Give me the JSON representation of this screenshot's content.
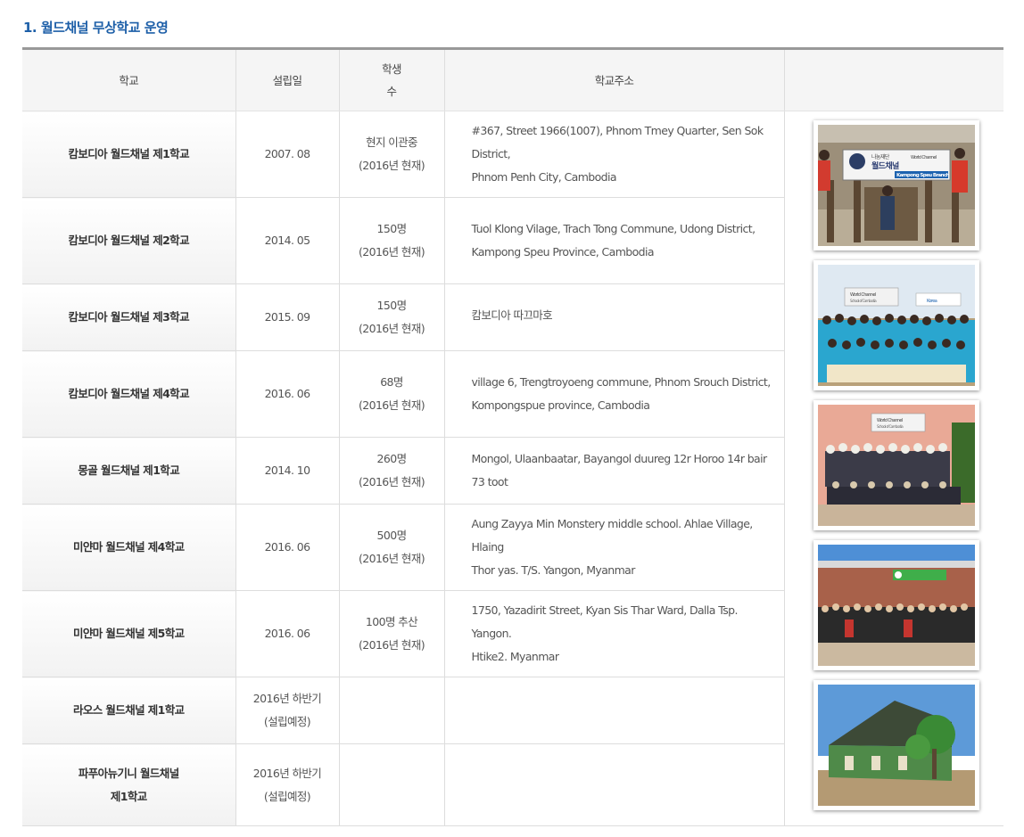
{
  "section_title": "1. 월드채널 무상학교 운영",
  "headers": {
    "school": "학교",
    "founded": "설립일",
    "students_line1": "학생",
    "students_line2": "수",
    "address": "학교주소",
    "photo": ""
  },
  "rows": [
    {
      "school": "캄보디아 월드채널 제1학교",
      "date": "2007. 08",
      "count": "현지 이관중",
      "count_note": "(2016년 현재)",
      "addr1": "#367, Street 1966(1007), Phnom Tmey Quarter, Sen Sok District,",
      "addr2": "Phnom Penh City, Cambodia"
    },
    {
      "school": "캄보디아 월드채널 제2학교",
      "date": "2014. 05",
      "count": "150명",
      "count_note": "(2016년 현재)",
      "addr1": "Tuol Klong Vilage, Trach Tong Commune, Udong District,",
      "addr2": "Kampong Speu Province, Cambodia"
    },
    {
      "school": "캄보디아 월드채널 제3학교",
      "date": "2015. 09",
      "count": "150명",
      "count_note": "(2016년 현재)",
      "addr1": "캄보디아 따끄마호",
      "addr2": ""
    },
    {
      "school": "캄보디아 월드채널 제4학교",
      "date": "2016. 06",
      "count": "68명",
      "count_note": "(2016년 현재)",
      "addr1": "village 6, Trengtroyoeng commune, Phnom Srouch District,",
      "addr2": "Kompongspue province, Cambodia"
    },
    {
      "school": "몽골 월드채널 제1학교",
      "date": "2014. 10",
      "count": "260명",
      "count_note": "(2016년 현재)",
      "addr1": "Mongol, Ulaanbaatar, Bayangol duureg 12r Horoo 14r bair 73 toot",
      "addr2": ""
    },
    {
      "school": "미얀마 월드채널 제4학교",
      "date": "2016. 06",
      "count": "500명",
      "count_note": "(2016년 현재)",
      "addr1": "Aung Zayya Min Monstery middle school. Ahlae Village, Hlaing",
      "addr2": "Thor yas. T/S. Yangon, Myanmar"
    },
    {
      "school": "미얀마 월드채널 제5학교",
      "date": "2016. 06",
      "count": "100명 추산",
      "count_note": "(2016년 현재)",
      "addr1": "1750, Yazadirit Street, Kyan Sis Thar Ward, Dalla Tsp. Yangon.",
      "addr2": "Htike2. Myanmar"
    },
    {
      "school": "라오스 월드채널 제1학교",
      "date": "2016년 하반기",
      "date_note": "(설립예정)",
      "count": "",
      "count_note": "",
      "addr1": "",
      "addr2": ""
    },
    {
      "school_line1": "파푸아뉴기니 월드채널",
      "school_line2": "제1학교",
      "date": "2016년 하반기",
      "date_note": "(설립예정)",
      "count": "",
      "count_note": "",
      "addr1": "",
      "addr2": ""
    }
  ],
  "photos": {
    "p1": {
      "sign_line1": "나눔재단",
      "sign_line2": "월드채널",
      "sign_right": "World Channel",
      "banner": "Kampong Speu Branch"
    },
    "p2": {
      "sign": "World Channel",
      "sign_sub": "School of Cambodia",
      "tag": "Korea"
    },
    "p3": {
      "sign": "World Channel",
      "sign_sub": "School of Cambodia"
    }
  }
}
